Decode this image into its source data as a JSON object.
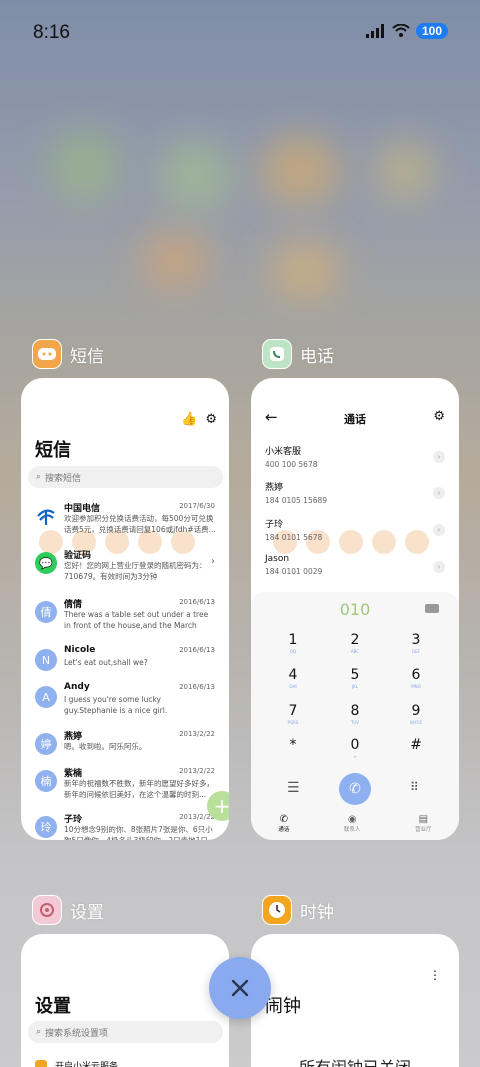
{
  "status": {
    "time": "8:16",
    "battery": "100"
  },
  "apps": {
    "sms": {
      "label": "短信",
      "title": "短信",
      "search_placeholder": "搜索短信",
      "messages": [
        {
          "avatar": "",
          "name": "中国电信",
          "date": "2017/6/30",
          "preview": "欢迎参加积分兑换话费活动，每500分可兑换话费5元，兑换话费请回复106或jfdh#话费..."
        },
        {
          "avatar": "",
          "name": "验证码",
          "date": "",
          "preview": "您好！您的网上营业厅登录的随机密码为：710679。有效时间为3分钟"
        },
        {
          "avatar": "倩",
          "name": "倩倩",
          "date": "2016/6/13",
          "preview": "There was a table set out under a tree in front of the house,and the March Hare an..."
        },
        {
          "avatar": "N",
          "name": "Nicole",
          "date": "2016/6/13",
          "preview": "Let's eat out,shall we?"
        },
        {
          "avatar": "A",
          "name": "Andy",
          "date": "2016/6/13",
          "preview": "I guess you're some lucky guy.Stephanie is a nice girl."
        },
        {
          "avatar": "婷",
          "name": "燕婷",
          "date": "2013/2/22",
          "preview": "嗯。收到啦。阿乐阿乐。"
        },
        {
          "avatar": "楠",
          "name": "紫楠",
          "date": "2013/2/22",
          "preview": "新年的祝福数不胜数，新年的愿望好多好多，新年的问候依旧美好，在这个温馨的时刻..."
        },
        {
          "avatar": "玲",
          "name": "子玲",
          "date": "2013/2/22",
          "preview": "10分想念9别的你、8张照片7张是你、6只小狗5只像你、4极名头3极印你、2只青地1只..."
        }
      ]
    },
    "phone": {
      "label": "电话",
      "title": "通话",
      "calls": [
        {
          "name": "小米客服",
          "number": "400 100 5678"
        },
        {
          "name": "燕婷",
          "number": "184 0105 15689"
        },
        {
          "name": "子玲",
          "number": "184 0101 5678"
        },
        {
          "name": "Jason",
          "number": "184 0101 0029"
        }
      ],
      "dial_input": "010",
      "keys": [
        {
          "d": "1",
          "l": "QQ"
        },
        {
          "d": "2",
          "l": "ABC"
        },
        {
          "d": "3",
          "l": "DEF"
        },
        {
          "d": "4",
          "l": "GHI"
        },
        {
          "d": "5",
          "l": "JKL"
        },
        {
          "d": "6",
          "l": "MNO"
        },
        {
          "d": "7",
          "l": "PQRS"
        },
        {
          "d": "8",
          "l": "TUV"
        },
        {
          "d": "9",
          "l": "WXYZ"
        },
        {
          "d": "*",
          "l": ""
        },
        {
          "d": "0",
          "l": "+"
        },
        {
          "d": "#",
          "l": ""
        }
      ],
      "tabs": [
        "通话",
        "联系人",
        "营业厅"
      ]
    },
    "settings": {
      "label": "设置",
      "title": "设置",
      "search_placeholder": "搜索系统设置项",
      "first_item": "开启小米云服务"
    },
    "clock": {
      "label": "时钟",
      "title": "闹钟",
      "empty_text": "所有闹钟已关闭"
    }
  },
  "colors": {
    "accent": "#8aaaf0",
    "dial_green": "#9cc87c",
    "battery": "#1e7cf2"
  }
}
